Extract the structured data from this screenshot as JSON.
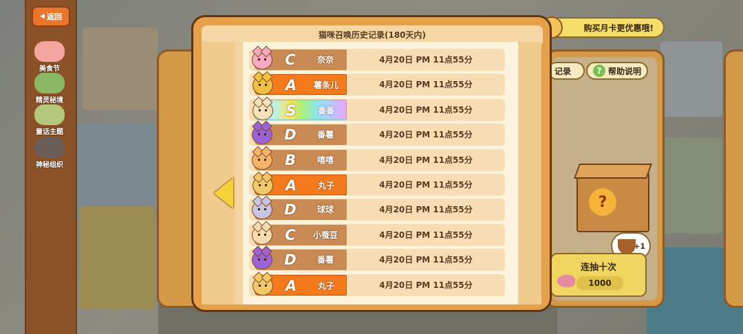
{
  "back_button": {
    "label": "返回"
  },
  "sidebar": {
    "items": [
      {
        "label": "美食节",
        "color": "#f3a5a0"
      },
      {
        "label": "精灵秘境",
        "color": "#8ab864"
      },
      {
        "label": "童话主题",
        "color": "#b5c77a"
      },
      {
        "label": "神秘组织",
        "color": "#6a5e58"
      }
    ]
  },
  "header": {
    "buy_monthly": "购买月卡更优惠哦!",
    "records_label": "记录",
    "help_label": "帮助说明"
  },
  "modal": {
    "title": "猫咪召唤历史记录(180天内)",
    "rows": [
      {
        "rank": "C",
        "name": "奈奈",
        "time": "4月20日 PM 11点55分",
        "avatar_color": "#f7a9c2"
      },
      {
        "rank": "A",
        "name": "薯条儿",
        "time": "4月20日 PM 11点55分",
        "avatar_color": "#f0c040"
      },
      {
        "rank": "S",
        "name": "番番",
        "time": "4月20日 PM 11点55分",
        "avatar_color": "#f5e2b8"
      },
      {
        "rank": "D",
        "name": "番薯",
        "time": "4月20日 PM 11点55分",
        "avatar_color": "#9c62d8"
      },
      {
        "rank": "B",
        "name": "嘻嘻",
        "time": "4月20日 PM 11点55分",
        "avatar_color": "#f5b46a"
      },
      {
        "rank": "A",
        "name": "丸子",
        "time": "4月20日 PM 11点55分",
        "avatar_color": "#f3c868"
      },
      {
        "rank": "D",
        "name": "球球",
        "time": "4月20日 PM 11点55分",
        "avatar_color": "#c9c4e0"
      },
      {
        "rank": "C",
        "name": "小蚕豆",
        "time": "4月20日 PM 11点55分",
        "avatar_color": "#f5dcb0"
      },
      {
        "rank": "D",
        "name": "番薯",
        "time": "4月20日 PM 11点55分",
        "avatar_color": "#9c62d8"
      },
      {
        "rank": "A",
        "name": "丸子",
        "time": "4月20日 PM 11点55分",
        "avatar_color": "#f3c868"
      }
    ]
  },
  "right_panel": {
    "plus_one": "+1",
    "draw_ten": {
      "label": "连抽十次",
      "cost": "1000"
    }
  }
}
